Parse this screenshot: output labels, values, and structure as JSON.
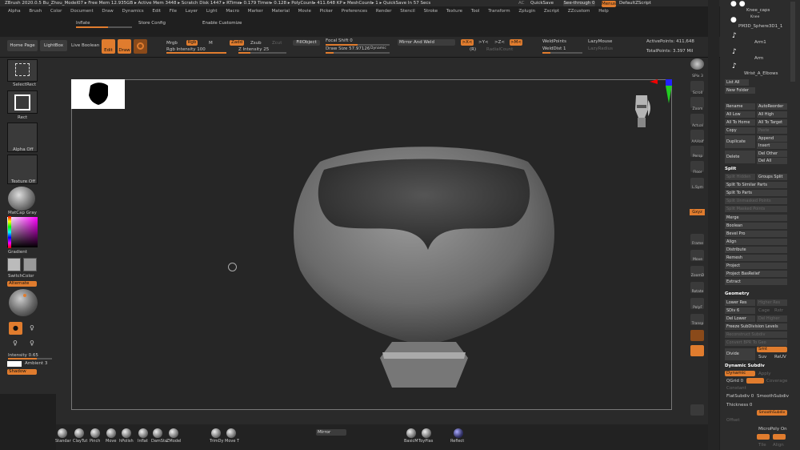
{
  "title_bar": "ZBrush 2020.0.5 Bu_Zhou_Model07   ▸ Free Mem 12.935GB ▸ Active Mem 3448 ▸ Scratch Disk 1447  ▸  RTime▸ 0.179 Timer▸ 0.128 ▸ PolyCount▸ 411.648 KP ▸ MeshCount▸ 1 ▸ QuickSave In 57 Secs",
  "title_right": {
    "ac": "AC",
    "quicksave": "QuickSave",
    "seethrough": "See-through 0",
    "menus": "Menus",
    "script": "DefaultZScript"
  },
  "menu_items": [
    "Alpha",
    "Brush",
    "Color",
    "Document",
    "Draw",
    "Dynamics",
    "Edit",
    "File",
    "Layer",
    "Light",
    "Macro",
    "Marker",
    "Material",
    "Movie",
    "Picker",
    "Preferences",
    "Render",
    "Stencil",
    "Stroke",
    "Texture",
    "Tool",
    "Transform",
    "Zplugin",
    "Zscript",
    "ZZcustom",
    "Help"
  ],
  "row3": {
    "inflate": "Inflate",
    "store_config": "Store Config",
    "enable_customize": "Enable Customize"
  },
  "toolbar": {
    "home_page": "Home Page",
    "lightbox": "LightBox",
    "live_boolean": "Live Boolean",
    "edit": "Edit",
    "draw": "Draw",
    "move": "Move",
    "mrgb": "Mrgb",
    "rgb": "Rgb",
    "m": "M",
    "rgb_intensity": "Rgb Intensity 100",
    "zadd": "Zadd",
    "zsub": "Zsub",
    "zcut": "Zcut",
    "z_intensity": "Z Intensity 25",
    "fill_object": "FillObject",
    "focal_shift": "Focal Shift 0",
    "draw_size": "Draw Size 57.97126",
    "dynamic": "Dynamic",
    "mirror_weld": "Mirror And Weld",
    "x": ">X<",
    "y": ">Y<",
    "z": ">Z<",
    "m2": ">M<",
    "r": "(R)",
    "radial_count": "RadialCount",
    "weld_points": "WeldPoints",
    "weld_dist": "WeldDist 1",
    "lazy_mouse": "LazyMouse",
    "lazy_radius": "LazyRadius",
    "active_points": "ActivePoints: 411,648",
    "total_points": "TotalPoints: 3.397 Mil"
  },
  "left_shelf": {
    "select_rect": "SelectRect",
    "rect": "Rect",
    "alpha_off": "Alpha Off",
    "texture_off": "Texture Off",
    "matcap": "MatCap Gray",
    "gradient": "Gradient",
    "switch_color": "SwitchColor",
    "alternate": "Alternate",
    "intensity": "Intensity 0.65",
    "ambient": "Ambient 3",
    "shadow": "Shadow"
  },
  "right_shelf": [
    "SPix 3",
    "Scroll",
    "Zoom",
    "Actual",
    "AAHalf",
    "Persp",
    "Floor",
    "L.Sym",
    "Gxyz",
    "Frame",
    "Move",
    "ZoomD",
    "Rotate",
    "PolyF",
    "Transp",
    "Dynamic",
    "Solo"
  ],
  "subtools": [
    {
      "name": "Knee_caps",
      "subname": "Knee"
    },
    {
      "name": "PM3D_Sphere3D1_1"
    },
    {
      "name": "Arm1"
    },
    {
      "name": "Arm"
    },
    {
      "name": "Wrist_A_Elbows"
    }
  ],
  "panel": {
    "list_all": "List All",
    "new_folder": "New Folder",
    "rename": "Rename",
    "auto_reorder": "AutoReorder",
    "all_low": "All Low",
    "all_high": "All High",
    "all_to_home": "All To Home",
    "all_to_target": "All To Target",
    "copy": "Copy",
    "paste": "Paste",
    "duplicate": "Duplicate",
    "append": "Append",
    "insert": "Insert",
    "delete": "Delete",
    "del_other": "Del Other",
    "del_all": "Del All",
    "split_head": "Split",
    "split_hidden": "Split Hidden",
    "groups_split": "Groups Split",
    "split_similar": "Split To Similar Parts",
    "split_parts": "Split To Parts",
    "split_unmasked": "Split Unmasked Points",
    "split_masked": "Split Masked Points",
    "merge": "Merge",
    "boolean": "Boolean",
    "bevel_pro": "Bevel Pro",
    "align": "Align",
    "distribute": "Distribute",
    "remesh": "Remesh",
    "project": "Project",
    "project_bas": "Project BasRelief",
    "extract": "Extract",
    "geometry": "Geometry",
    "lower_res": "Lower Res",
    "higher_res": "Higher Res",
    "sdiv": "SDiv 6",
    "cage": "Cage",
    "rstr": "Rstr",
    "del_lower": "Del Lower",
    "del_higher": "Del Higher",
    "freeze": "Freeze SubDivision Levels",
    "reconstruct": "Reconstruct Subdiv",
    "convert_bpr": "Convert BPR To Geo",
    "divide": "Divide",
    "smt": "Smt",
    "suv": "Suv",
    "reuv": "ReUV",
    "dynamic_subdiv": "Dynamic Subdiv",
    "dynamic": "Dynamic",
    "apply": "Apply",
    "qgrid": "QGrid 0",
    "coverage": "Coverage",
    "constant": "Constant",
    "flatsubdiv": "FlatSubdiv 0",
    "smoothsubdiv": "SmoothSubdiv",
    "thickness": "Thickness 0",
    "offset": "Offset",
    "smt_subdiv": "SmoothSubdiv",
    "micropoly": "MicroPoly On",
    "tile": "Tile",
    "align2": "Align"
  },
  "bottom": {
    "brushes": [
      "Standar",
      "ClayTut",
      "Pinch",
      "Move",
      "hPolish",
      "Inflat",
      "DamSta",
      "ZModel"
    ],
    "trim": "TrimDy",
    "move_t": "Move T",
    "mirror": "Mirror",
    "mats": [
      "BasicM",
      "ToyPlas"
    ],
    "reflect": "Reflect"
  },
  "colors": {
    "accent": "#e07c2e",
    "bg": "#1f1f1f",
    "panel": "#2c2c2c"
  }
}
